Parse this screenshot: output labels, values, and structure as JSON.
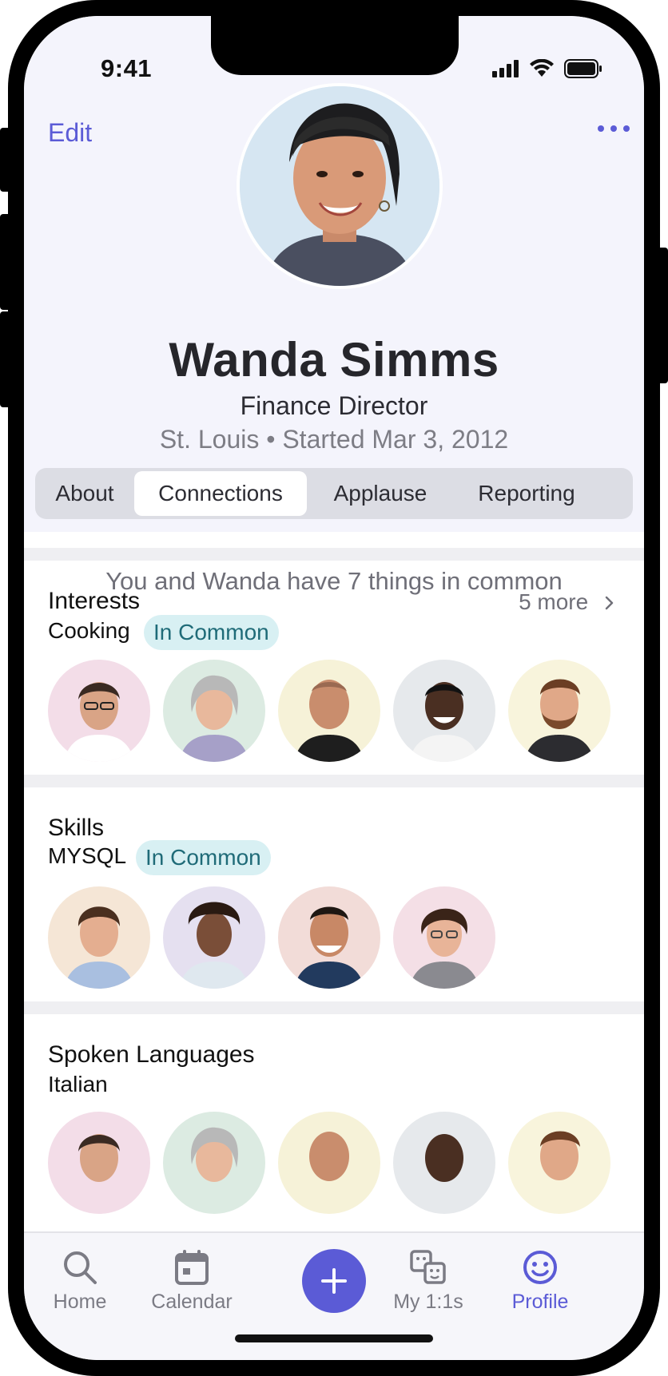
{
  "status_bar": {
    "time": "9:41"
  },
  "header": {
    "edit_label": "Edit",
    "name": "Wanda Simms",
    "job_title": "Finance Director",
    "location_line": "St. Louis • Started Mar 3, 2012"
  },
  "tabs": [
    {
      "label": "About",
      "active": false
    },
    {
      "label": "Connections",
      "active": true
    },
    {
      "label": "Applause",
      "active": false
    },
    {
      "label": "Reporting",
      "active": false
    }
  ],
  "common_summary": "You and Wanda have 7 things in common",
  "sections": {
    "interests": {
      "title": "Interests",
      "item": "Cooking",
      "badge": "In Common",
      "more": "5 more"
    },
    "skills": {
      "title": "Skills",
      "item": "MYSQL",
      "badge": "In Common"
    },
    "languages": {
      "title": "Spoken Languages",
      "item": "Italian"
    }
  },
  "tabbar": {
    "home": "Home",
    "calendar": "Calendar",
    "my_11s": "My 1:1s",
    "profile": "Profile"
  },
  "colors": {
    "accent": "#5b5bd6",
    "header_bg": "#f4f4fc",
    "badge_bg": "#d8f0f3",
    "badge_text": "#1f6b78"
  }
}
